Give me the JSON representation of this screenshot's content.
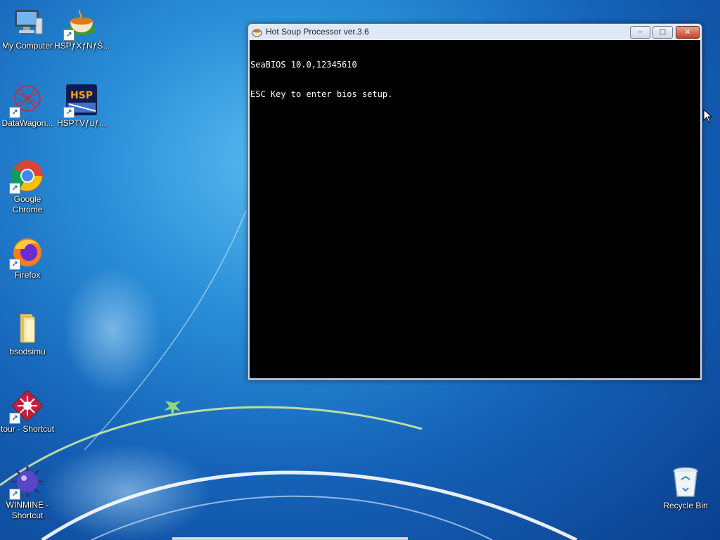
{
  "desktop": {
    "icons": [
      {
        "label": "My Computer",
        "icon": "computer-icon"
      },
      {
        "label": "HSPƒXƒNƒŠ...",
        "icon": "hsp-soup-icon"
      },
      {
        "label": "DataWagon...",
        "icon": "datawagon-icon"
      },
      {
        "label": "HSPTVƒuƒ...",
        "icon": "hsptv-icon"
      },
      {
        "label": "Google Chrome",
        "icon": "chrome-icon"
      },
      {
        "label": "Firefox",
        "icon": "firefox-icon"
      },
      {
        "label": "bsodsimu",
        "icon": "folder-icon"
      },
      {
        "label": "tour - Shortcut",
        "icon": "tour-icon"
      },
      {
        "label": "WINMINE - Shortcut",
        "icon": "winmine-icon"
      },
      {
        "label": "Recycle Bin",
        "icon": "recycle-bin-icon"
      }
    ]
  },
  "window": {
    "title": "Hot Soup Processor ver.3.6",
    "minimize_label": "‒",
    "maximize_label": "□",
    "close_label": "✕",
    "console_lines": [
      "SeaBIOS 10.0,12345610",
      "ESC Key to enter bios setup."
    ]
  }
}
